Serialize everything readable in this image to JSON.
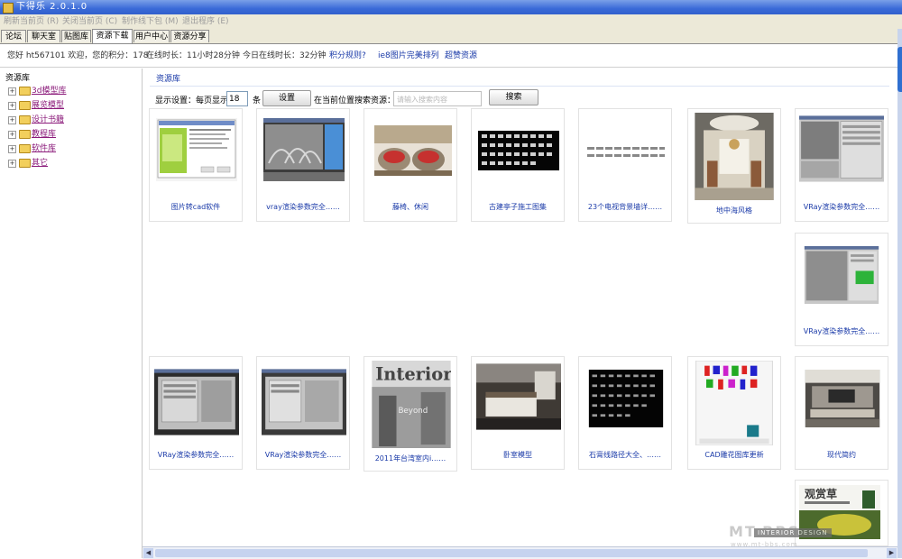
{
  "window": {
    "title": "下得乐 2.0.1.0"
  },
  "menu": {
    "items": [
      "刷新当前页 (R)",
      "关闭当前页 (C)",
      "制作线下包 (M)",
      "退出程序 (E)"
    ]
  },
  "tabs": [
    {
      "label": "论坛",
      "active": false
    },
    {
      "label": "聊天室",
      "active": false
    },
    {
      "label": "贴图库",
      "active": false
    },
    {
      "label": "资源下载",
      "active": true
    },
    {
      "label": "用户中心",
      "active": false
    },
    {
      "label": "资源分享",
      "active": false
    }
  ],
  "info": {
    "greeting": "您好 ht567101 欢迎，您的积分：178",
    "online_time": "在线时长：11小时28分钟",
    "today_online": "今日在线时长：32分钟",
    "link_rules": "积分规则?",
    "link_ie8": "ie8图片完美排列",
    "link_resource": "超赞资源"
  },
  "sidebar": {
    "header": "资源库",
    "items": [
      {
        "label": "3d模型库"
      },
      {
        "label": "展览模型"
      },
      {
        "label": "设计书籍"
      },
      {
        "label": "教程库"
      },
      {
        "label": "软件库"
      },
      {
        "label": "其它"
      }
    ]
  },
  "main": {
    "title": "资源库",
    "display_label": "显示设置：每页显示",
    "per_page": "18",
    "per_page_unit": "条",
    "set_button": "设置",
    "search_label": "在当前位置搜索资源：",
    "search_placeholder": "请输入搜索内容",
    "search_button": "搜索"
  },
  "cards": [
    {
      "caption": "图片转cad软件",
      "thumb": "software-window-green"
    },
    {
      "caption": "vray渲染参数完全……",
      "thumb": "render-colosseum"
    },
    {
      "caption": "藤椅、休闲",
      "thumb": "rattan-chairs"
    },
    {
      "caption": "古建亭子施工图集",
      "thumb": "dark-cad-drawings"
    },
    {
      "caption": "23个电视背景墙详……",
      "thumb": "small-elevation-sketches"
    },
    {
      "caption": "地中海风格",
      "thumb": "mediterranean-interior"
    },
    {
      "caption": "VRay渲染参数完全……",
      "thumb": "software-settings-grey"
    },
    {
      "caption": "VRay渲染参数完全……",
      "thumb": "software-green-object"
    },
    {
      "caption": "VRay渲染参数完全……",
      "thumb": "software-dialog-dark"
    },
    {
      "caption": "VRay渲染参数完全……",
      "thumb": "software-dialog-grey"
    },
    {
      "caption": "2011年台湾室内i……",
      "thumb": "interior-magazine-cover"
    },
    {
      "caption": "卧室模型",
      "thumb": "bedroom-render"
    },
    {
      "caption": "石膏线路径大全、……",
      "thumb": "dark-molding-profiles"
    },
    {
      "caption": "CAD雕花图库更新",
      "thumb": "cad-carving-library"
    },
    {
      "caption": "现代简约",
      "thumb": "modern-living-room"
    },
    {
      "caption": "",
      "thumb": "book-cover-guanshangcao"
    }
  ],
  "watermark": {
    "brand": "MT-BBS",
    "banner": "INTERIOR DESIGN",
    "url": "www.mt-bbs.com"
  },
  "colors": {
    "title_bar": "#3a6ad8",
    "link": "#1a3aa8",
    "tree_link": "#8b1a7a",
    "menu_bg": "#ece9d8"
  }
}
